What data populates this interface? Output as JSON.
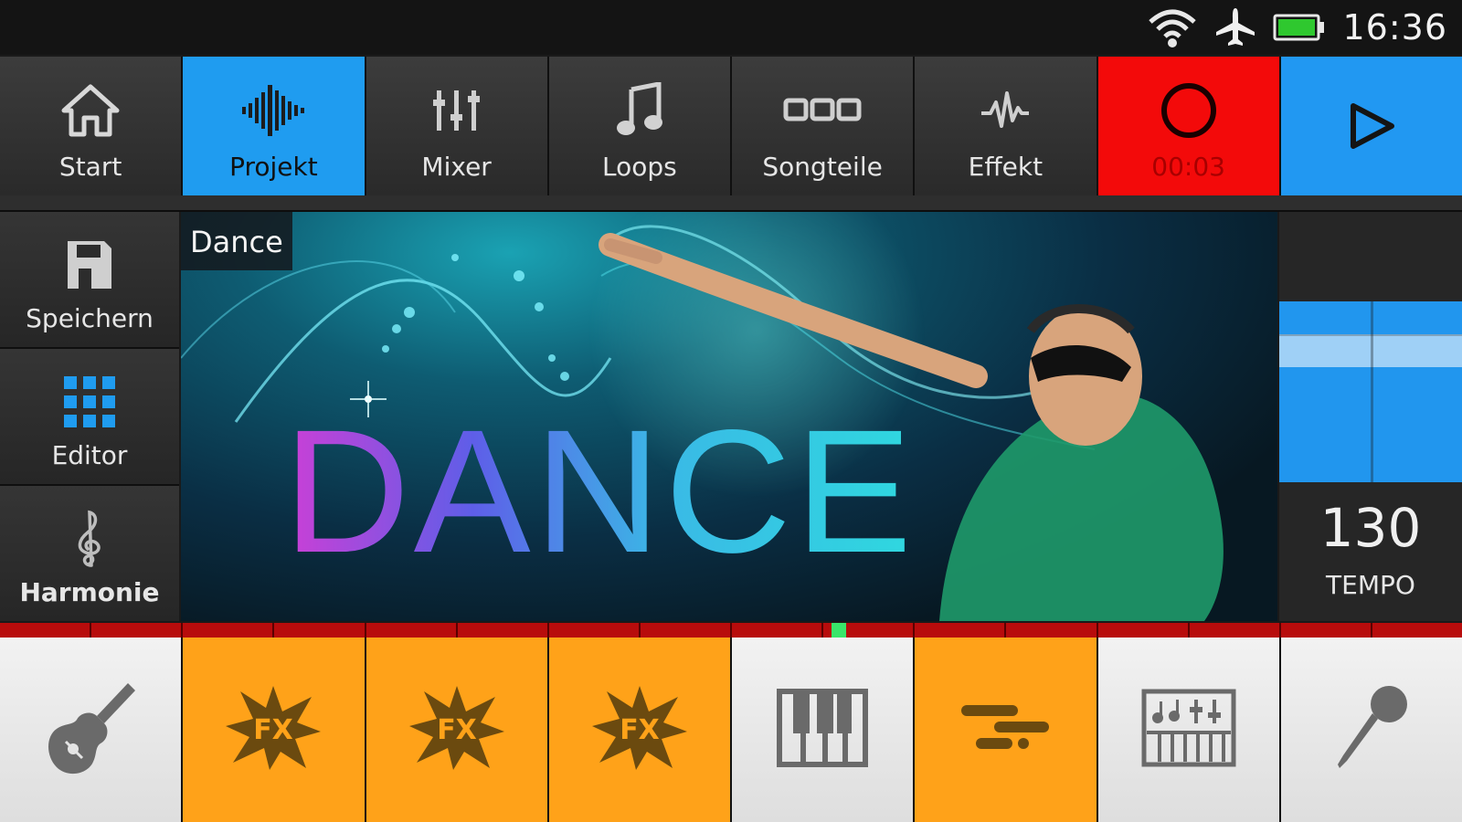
{
  "status": {
    "time": "16:36",
    "battery_color": "#2fc82f"
  },
  "toolbar": {
    "items": [
      {
        "label": "Start",
        "icon": "home-icon"
      },
      {
        "label": "Projekt",
        "icon": "waveform-icon",
        "active": true
      },
      {
        "label": "Mixer",
        "icon": "mixer-sliders-icon"
      },
      {
        "label": "Loops",
        "icon": "music-note-icon"
      },
      {
        "label": "Songteile",
        "icon": "song-parts-icon"
      },
      {
        "label": "Effekt",
        "icon": "effect-wave-icon"
      },
      {
        "label": "00:03",
        "icon": "record-icon"
      },
      {
        "icon": "play-icon"
      }
    ]
  },
  "sidebar": {
    "items": [
      {
        "label": "Speichern",
        "icon": "save-icon"
      },
      {
        "label": "Editor",
        "icon": "grid-icon"
      },
      {
        "label": "Harmonie",
        "icon": "treble-clef-icon"
      }
    ]
  },
  "banner": {
    "tag": "Dance",
    "title": "DANCE"
  },
  "tempo": {
    "value": "130",
    "label": "TEMPO"
  },
  "instruments": [
    {
      "icon": "guitar-icon",
      "style": "white"
    },
    {
      "icon": "fx-icon",
      "text": "FX",
      "style": "orange"
    },
    {
      "icon": "fx-icon",
      "text": "FX",
      "style": "orange"
    },
    {
      "icon": "fx-icon",
      "text": "FX",
      "style": "orange"
    },
    {
      "icon": "piano-keys-icon",
      "style": "white"
    },
    {
      "icon": "bars-icon",
      "style": "orange"
    },
    {
      "icon": "synth-keyboard-icon",
      "style": "white"
    },
    {
      "icon": "microphone-icon",
      "style": "white"
    }
  ],
  "colors": {
    "accent_blue": "#1f9cf0",
    "record_red": "#f30a0a",
    "pad_orange": "#ffa219",
    "timeline_red": "#b80c0c",
    "playhead_green": "#39e66a"
  }
}
